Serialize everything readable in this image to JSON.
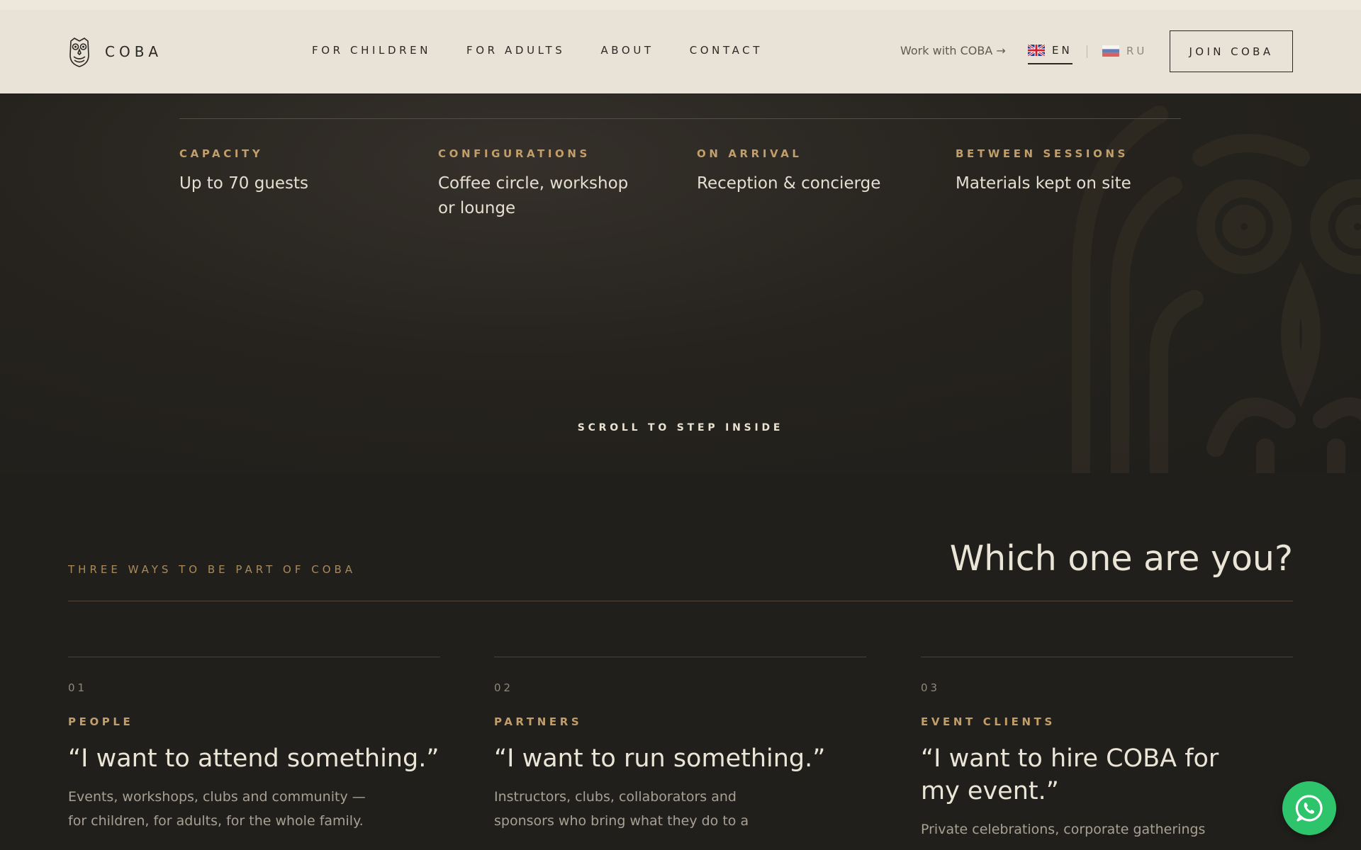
{
  "header": {
    "logo_text": "COBA",
    "nav": [
      "FOR CHILDREN",
      "FOR ADULTS",
      "ABOUT",
      "CONTACT"
    ],
    "work_link": "Work with COBA  →",
    "lang_en": "EN",
    "lang_ru": "RU",
    "join_label": "JOIN COBA"
  },
  "stats": [
    {
      "label": "CAPACITY",
      "value": "Up to 70 guests"
    },
    {
      "label": "CONFIGURATIONS",
      "value": "Coffee circle, workshop or lounge"
    },
    {
      "label": "ON ARRIVAL",
      "value": "Reception & concierge"
    },
    {
      "label": "BETWEEN SESSIONS",
      "value": "Materials kept on site"
    }
  ],
  "scroll_hint": "SCROLL TO STEP INSIDE",
  "ways": {
    "eyebrow": "THREE WAYS TO BE PART OF COBA",
    "title": "Which one are you?",
    "cards": [
      {
        "num": "01",
        "label": "PEOPLE",
        "quote": "“I want to attend something.”",
        "text": "Events, workshops, clubs and community — for children, for adults, for the whole family."
      },
      {
        "num": "02",
        "label": "PARTNERS",
        "quote": "“I want to run something.”",
        "text": "Instructors, clubs, collaborators and sponsors who bring what they do to a"
      },
      {
        "num": "03",
        "label": "EVENT CLIENTS",
        "quote": "“I want to hire COBA for my event.”",
        "text": "Private celebrations, corporate gatherings"
      }
    ]
  },
  "colors": {
    "accent": "#c29e6a",
    "whatsapp": "#2dc46b",
    "header_bg": "#e8e3d6",
    "page_bg": "#201f1b"
  },
  "icons": [
    "owl-logo-icon",
    "uk-flag-icon",
    "russia-flag-icon",
    "ornament-pattern",
    "whatsapp-icon"
  ]
}
